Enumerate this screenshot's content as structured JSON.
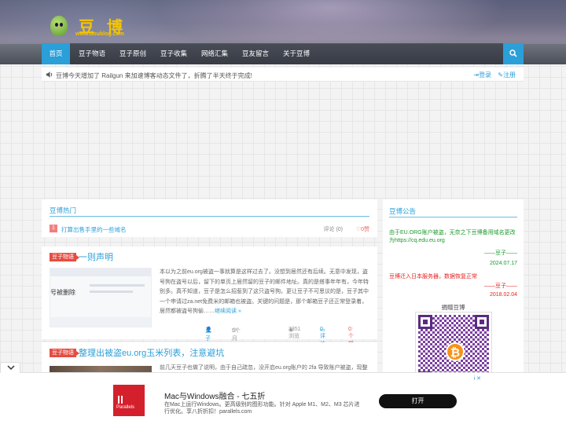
{
  "header": {
    "logo_text": "豆博",
    "logo_domain": "www.doublog.com"
  },
  "nav": {
    "items": [
      {
        "label": "首页",
        "active": true
      },
      {
        "label": "豆子物语"
      },
      {
        "label": "豆子原创"
      },
      {
        "label": "豆子收集"
      },
      {
        "label": "网络汇集"
      },
      {
        "label": "豆友留言"
      },
      {
        "label": "关于豆博"
      }
    ]
  },
  "notice": {
    "text": "豆博今天增加了 Railgun 来加速博客动态文件了，折腾了半天终于完成!",
    "login": "登录",
    "register": "注册"
  },
  "hot": {
    "title": "豆博热门",
    "items": [
      {
        "rank": "1",
        "title": "打算出售手里的一些域名",
        "comments": "评论 (0)",
        "likes": "0赞"
      }
    ]
  },
  "articles": [
    {
      "category": "豆子物语",
      "title": "一则声明",
      "thumb_text": "号被删除",
      "excerpt": "本以为之前eu.org被盗一事就算是这样过去了。没想到居然还有后续。无意中发现，盗号狗在盗号以后，留下的单页上居然留的豆子的邮件地址。真的是搭事年年有，今年特别多。真不知道，豆子是怎么招惹到了这只盗号狗。更让豆子不可思议的是，豆子其中一个申请过za.net免费米的邮箱也被盗。关键的问题是，那个邮箱豆子还正常登录着，居然都被盗号狗偷……",
      "more": "继续阅读 »",
      "author": "豆子",
      "time": "5个月前 (09-20)",
      "views": "3351浏览",
      "comments": "0评论",
      "likes": "0个赞"
    },
    {
      "category": "豆子物语",
      "title": "整理出被盗eu.org玉米列表，注意避坑",
      "excerpt": "前几天豆子也做了说明，由于自己疏忽，没开启eu.org账户的 2fa 导致账户被盗，现整"
    }
  ],
  "sidebar": {
    "title": "豆博公告",
    "announce1": "由于EU.ORG账户被盗，无奈之下豆博备用域名更改为https://cq.edu.eu.org",
    "sig1": "——豆子——",
    "date1": "2024.07.17",
    "announce2": "豆博迁入日本服务器，数据恢复正常",
    "sig2": "——豆子——",
    "date2": "2018.02.04",
    "donate": "捐赠豆博",
    "btc_symbol": "₿"
  },
  "ad": {
    "brand": "Parallels",
    "title": "Mac与Windows融合 - 七五折",
    "desc": "在Mac上运行Windows。更高级别的图形功能。针对 Apple M1、M2、M3 芯片进行优化。享八折折扣！parallels.com",
    "button": "打开",
    "choices": "i ✕"
  },
  "colors": {
    "accent": "#2a9fd8",
    "tag_red": "#e54d42",
    "green_notice": "#1a9a2a",
    "red_notice": "#e62020"
  }
}
